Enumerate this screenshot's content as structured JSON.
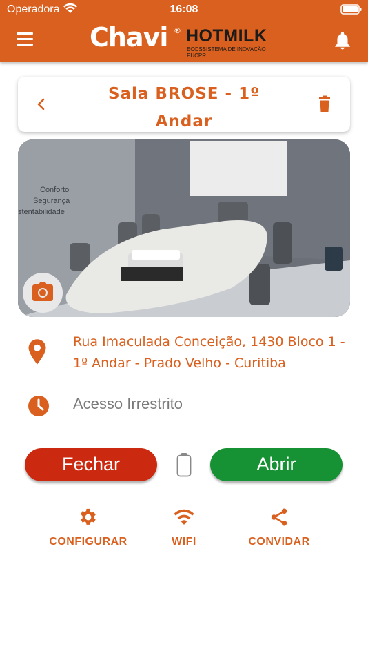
{
  "status_bar": {
    "carrier": "Operadora",
    "time": "16:08"
  },
  "header": {
    "logo_main": "Chavi",
    "logo_reg": "®",
    "logo_partner": "HOTMILK",
    "logo_partner_sub": "ECOSSISTEMA DE INOVAÇÃO PUCPR"
  },
  "room": {
    "title": "Sala BROSE - 1º Andar",
    "address": "Rua Imaculada Conceição, 1430 Bloco 1 - 1º Andar - Prado Velho - Curitiba",
    "access": "Acesso Irrestrito",
    "photo_wall_text": [
      "Conforto",
      "Segurança",
      "stentabilidade"
    ]
  },
  "controls": {
    "close_label": "Fechar",
    "open_label": "Abrir"
  },
  "actions": [
    {
      "label": "CONFIGURAR",
      "icon": "gear-icon"
    },
    {
      "label": "WIFI",
      "icon": "wifi-icon"
    },
    {
      "label": "CONVIDAR",
      "icon": "share-icon"
    }
  ],
  "colors": {
    "brand_orange": "#d9601e",
    "close_red": "#cc2a10",
    "open_green": "#169133",
    "muted_gray": "#7a7a7a"
  }
}
